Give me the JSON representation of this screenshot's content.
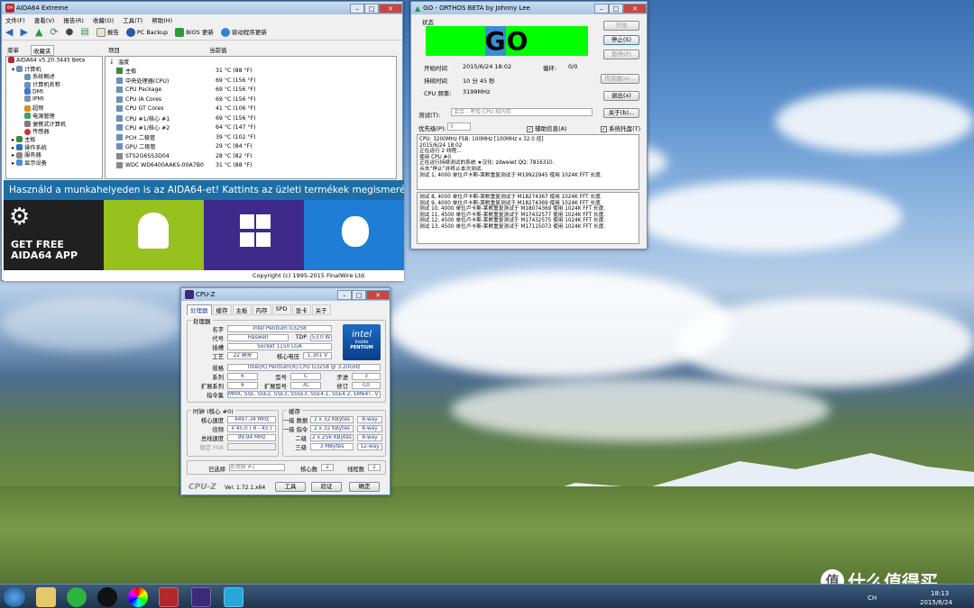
{
  "aida": {
    "title": "AIDA64 Extreme",
    "menu": [
      "文件(F)",
      "查看(V)",
      "报告(R)",
      "收藏(O)",
      "工具(T)",
      "帮助(H)"
    ],
    "toolbar": [
      "报告",
      "PC Backup",
      "BIOS 更新",
      "驱动程序更新"
    ],
    "tabs": [
      "菜单",
      "收藏夹"
    ],
    "col_item": "项目",
    "col_value": "当前值",
    "tree": [
      "AIDA64 v5.20.3445 Beta",
      "计算机",
      "系统概述",
      "计算机名称",
      "DMI",
      "IPMI",
      "超频",
      "电源管理",
      "便携式计算机",
      "传感器",
      "主板",
      "操作系统",
      "服务器",
      "显示设备"
    ],
    "group": "温度",
    "rows": [
      [
        "主板",
        "31 °C  (88 °F)"
      ],
      [
        "中央处理器(CPU)",
        "69 °C  (156 °F)"
      ],
      [
        "CPU Package",
        "69 °C  (156 °F)"
      ],
      [
        "CPU IA Cores",
        "69 °C  (156 °F)"
      ],
      [
        "CPU GT Cores",
        "41 °C  (106 °F)"
      ],
      [
        "CPU #1/核心 #1",
        "69 °C  (156 °F)"
      ],
      [
        "CPU #1/核心 #2",
        "64 °C  (147 °F)"
      ],
      [
        "PCH 二极管",
        "39 °C  (102 °F)"
      ],
      [
        "GPU 二极管",
        "29 °C  (84 °F)"
      ],
      [
        "STS2G6SS3D04",
        "28 °C  (82 °F)"
      ],
      [
        "WDC WD6400AAKS-00A7B0",
        "31 °C  (88 °F)"
      ]
    ],
    "banner": "Használd a munkahelyeden is az AIDA64-et! Kattints az üzleti termékek megismeréséhez",
    "ad": "GET FREE AIDA64 APP",
    "copyright": "Copyright (c) 1995-2015 FinalWire Ltd."
  },
  "orthos": {
    "title": "GO - ORTHOS BETA by Johnny Lee",
    "status_label": "状态",
    "go": "GO",
    "start_label": "开始时间",
    "start_value": "2015/6/24 18:02",
    "loop_label": "循环:",
    "loop_value": "0/0",
    "dur_label": "持续时间",
    "dur_value": "10 分 45 秒",
    "freq_label": "CPU 频率:",
    "freq_value": "3199MHz",
    "btns": [
      "开始",
      "停止(S)",
      "暂停(P)",
      "传感器(e)...",
      "退出(x)",
      "关于(b)..."
    ],
    "test_label": "测试(T):",
    "test_value": "混合 - 考验 CPU 和内存",
    "prio_label": "优先级(P):",
    "prio_value": "9",
    "chk1": "辅助信息(A)",
    "chk2": "系统托盘(T)",
    "log1": [
      "CPU: 3200MHz FSB: 100MHz [100MHz x 32.0 倍]",
      "2015/6/24 18:02",
      "正在运行 2 线程...",
      "使用 CPU #0",
      "正在运行持续测试的系统    ★汉化: zdweiwt QQ: 7816310.",
      "点击“停止”并终止本次测试.",
      "测试 1, 4000 单位卢卡斯-莱默重复测试于 M19922945 使用 1024K FFT 长度."
    ],
    "log2": [
      "测试 8, 4000 单位卢卡斯-莱默重复测试于 M18274367 使用 1024K FFT 长度.",
      "测试 9, 4000 单位卢卡斯-莱默重复测试于 M18274369 使用 1024K FFT 长度.",
      "测试 10, 4000 单位卢卡斯-莱默重复测试于 M18074369 使用 1024K FFT 长度.",
      "测试 11, 4500 单位卢卡斯-莱默重复测试于 M17432577 使用 1024K FFT 长度.",
      "测试 12, 4500 单位卢卡斯-莱默重复测试于 M17432575 使用 1024K FFT 长度.",
      "测试 13, 4500 单位卢卡斯-莱默重复测试于 M17115073 使用 1024K FFT 长度."
    ]
  },
  "cpuz": {
    "title": "CPU-Z",
    "tabs": [
      "处理器",
      "缓存",
      "主板",
      "内存",
      "SPD",
      "显卡",
      "关于"
    ],
    "proc_group": "处理器",
    "name_l": "名字",
    "name_v": "Intel Pentium G3258",
    "code_l": "代号",
    "code_v": "Haswell",
    "tdp_l": "TDP",
    "tdp_v": "53.0 W",
    "socket_l": "插槽",
    "socket_v": "Socket 1150 LGA",
    "tech_l": "工艺",
    "tech_v": "22 纳米",
    "volt_l": "核心电压",
    "volt_v": "1.301 V",
    "spec_l": "规格",
    "spec_v": "Intel(R) Pentium(R) CPU G3258 @ 3.20GHz",
    "fam_l": "系列",
    "fam_v": "6",
    "model_l": "型号",
    "model_v": "C",
    "step_l": "步进",
    "step_v": "3",
    "efam_l": "扩展系列",
    "efam_v": "6",
    "emodel_l": "扩展型号",
    "emodel_v": "3C",
    "rev_l": "修订",
    "rev_v": "C0",
    "inst_l": "指令集",
    "inst_v": "MMX, SSE, SSE2, SSE3, SSSE3, SSE4.1, SSE4.2, EM64T, VT-x",
    "clock_group": "时钟 (核心 #0)",
    "core_l": "核心速度",
    "core_v": "4497.34 MHz",
    "mult_l": "倍频",
    "mult_v": "x 45.0 ( 8 - 45 )",
    "bus_l": "总线速度",
    "bus_v": "99.94 MHz",
    "fsb_l": "额定 FSB",
    "cache_group": "缓存",
    "l1d_l": "一级 数据",
    "l1d_v": "2 x 32 KBytes",
    "l1d_w": "8-way",
    "l1i_l": "一级 指令",
    "l1i_v": "2 x 32 KBytes",
    "l1i_w": "8-way",
    "l2_l": "二级",
    "l2_v": "2 x 256 KBytes",
    "l2_w": "8-way",
    "l3_l": "三级",
    "l3_v": "3 MBytes",
    "l3_w": "12-way",
    "sel_l": "已选择",
    "sel_v": "处理器 #1",
    "cores_l": "核心数",
    "cores_v": "2",
    "threads_l": "线程数",
    "threads_v": "2",
    "brand": "CPU-Z",
    "ver": "Ver. 1.72.1.x64",
    "tools": "工具",
    "validate": "验证",
    "ok": "确定",
    "intel1": "intel",
    "intel2": "inside",
    "intel3": "PENTIUM"
  },
  "tray": {
    "time": "18:13",
    "date": "2015/6/24",
    "lang": "CH"
  },
  "watermark": {
    "text": "什么值得买",
    "badge": "值"
  }
}
